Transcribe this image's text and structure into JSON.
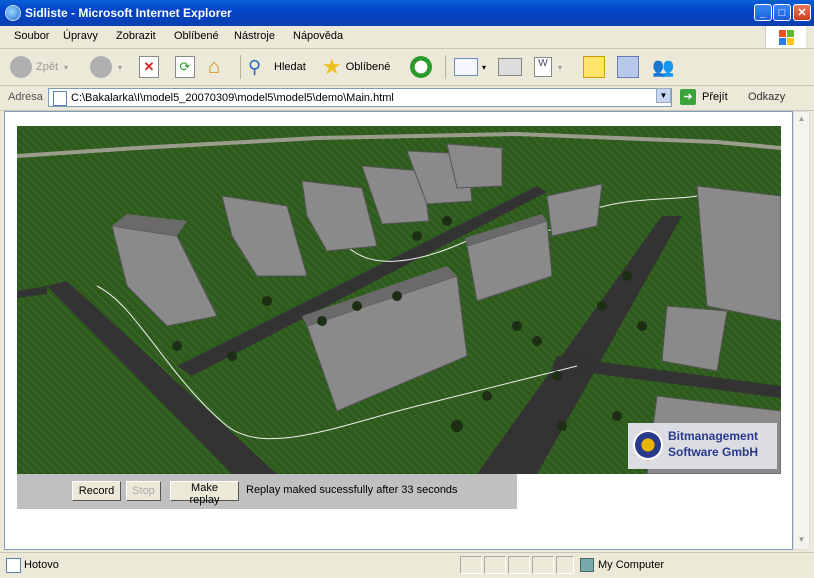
{
  "window": {
    "title": "Sidliste - Microsoft Internet Explorer"
  },
  "menu": [
    "Soubor",
    "Úpravy",
    "Zobrazit",
    "Oblíbené",
    "Nástroje",
    "Nápověda"
  ],
  "toolbar": {
    "back_label": "Zpět",
    "search_label": "Hledat",
    "favorites_label": "Oblíbené"
  },
  "address": {
    "label": "Adresa",
    "url": "C:\\Bakalarka\\I\\model5_20070309\\model5\\model5\\demo\\Main.html",
    "go_label": "Přejít",
    "links_label": "Odkazy"
  },
  "page": {
    "buttons": {
      "record": "Record",
      "stop": "Stop",
      "replay": "Make replay"
    },
    "message": "Replay maked sucessfully after 33 seconds",
    "logo_line1": "Bitmanagement",
    "logo_line2": "Software GmbH"
  },
  "status": {
    "text": "Hotovo",
    "zone": "My Computer"
  },
  "colors": {
    "title_bar": "#0a5fd8",
    "grass": "#2f5a1f",
    "road": "#333333"
  }
}
